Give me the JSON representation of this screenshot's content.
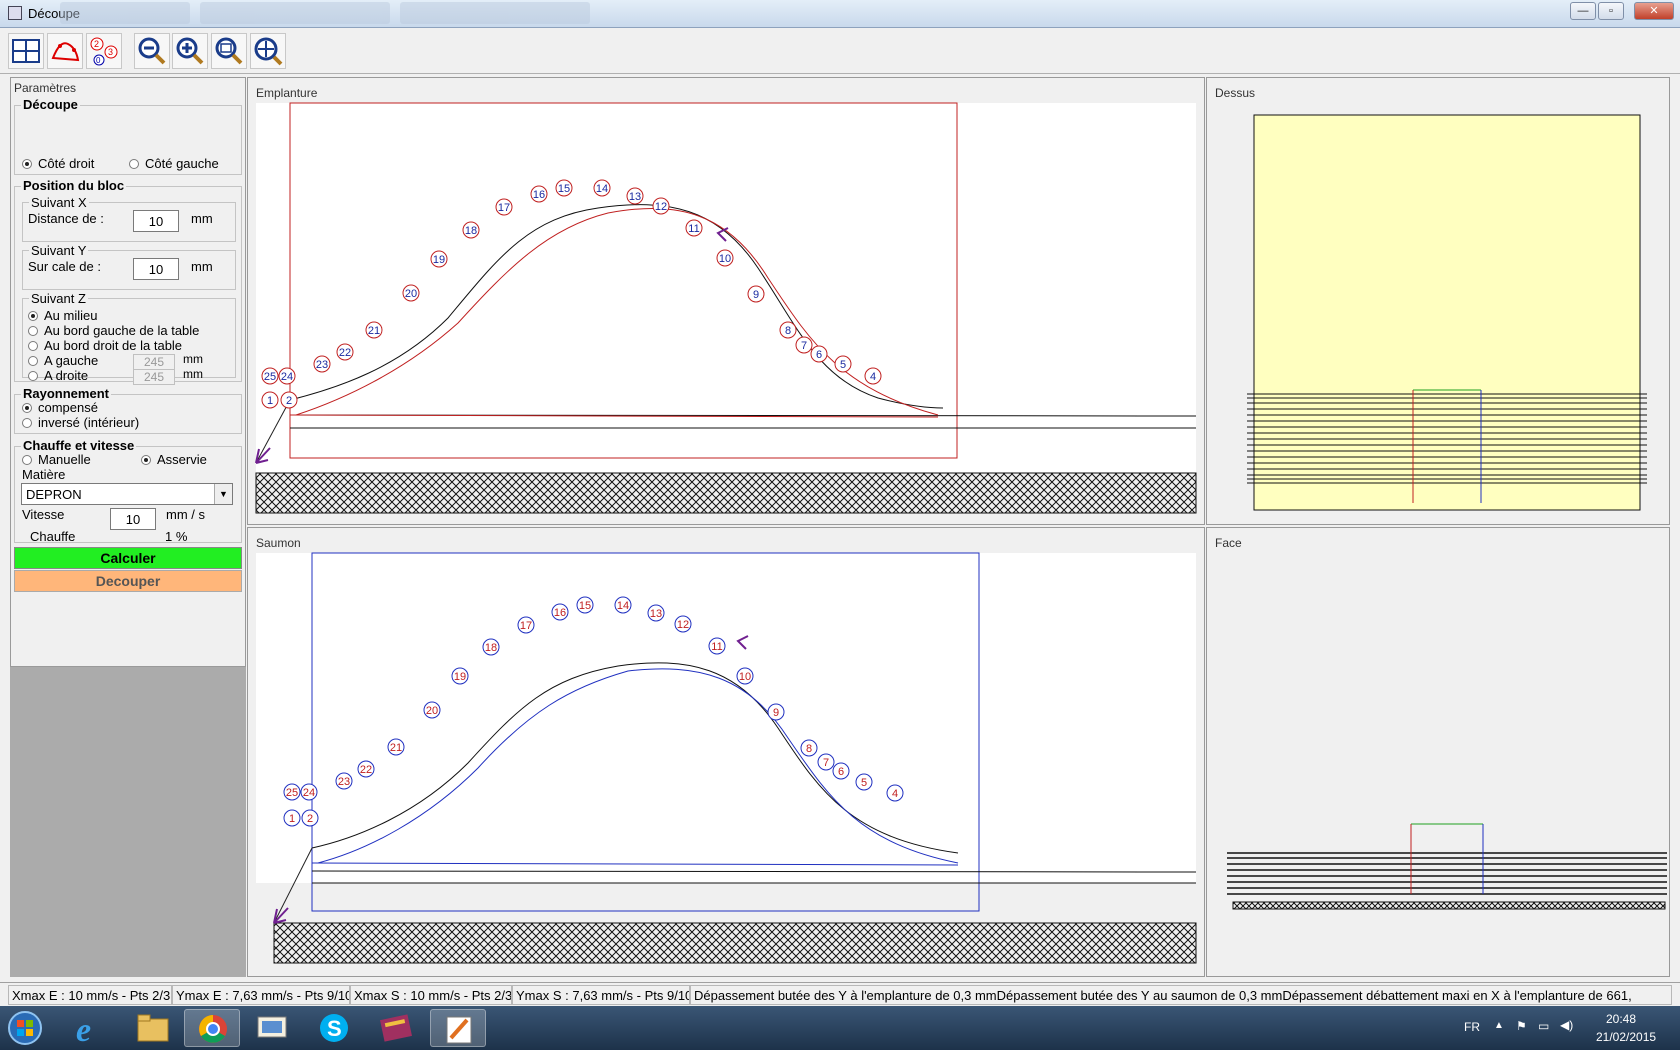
{
  "window": {
    "title": "Découpe",
    "controls": [
      "minimize",
      "maximize",
      "close"
    ]
  },
  "toolbar": {
    "buttons": [
      {
        "name": "layout-grid-icon"
      },
      {
        "name": "profile-points-icon"
      },
      {
        "name": "numbered-points-icon"
      },
      {
        "name": "zoom-out-icon"
      },
      {
        "name": "zoom-in-icon"
      },
      {
        "name": "zoom-fit-icon"
      },
      {
        "name": "pan-icon"
      }
    ]
  },
  "params": {
    "title": "Paramètres",
    "decoupe": {
      "title": "Découpe",
      "cote_droit": "Côté droit",
      "cote_gauche": "Côté gauche",
      "selected": "Côté droit"
    },
    "position": {
      "title": "Position du bloc",
      "suivant_x": "Suivant X",
      "distance_label": "Distance de :",
      "distance_value": "10",
      "distance_unit": "mm",
      "suivant_y": "Suivant Y",
      "cale_label": "Sur cale de :",
      "cale_value": "10",
      "cale_unit": "mm",
      "suivant_z": "Suivant Z",
      "z_options": [
        "Au milieu",
        "Au bord gauche de la table",
        "Au bord droit de la table",
        "A gauche",
        "A droite"
      ],
      "z_selected": "Au milieu",
      "gauche_value": "245",
      "droite_value": "245",
      "z_unit": "mm"
    },
    "rayonnement": {
      "title": "Rayonnement",
      "compense": "compensé",
      "inverse": "inversé (intérieur)",
      "selected": "compensé"
    },
    "chauffe": {
      "title": "Chauffe et vitesse",
      "manuelle": "Manuelle",
      "asservie": "Asservie",
      "selected": "Asservie",
      "matiere_label": "Matière",
      "matiere_value": "DEPRON",
      "vitesse_label": "Vitesse",
      "vitesse_value": "10",
      "vitesse_unit": "mm / s",
      "chauffe_label": "Chauffe",
      "chauffe_value": "1 %"
    },
    "calculer": "Calculer",
    "decouper": "Decouper"
  },
  "views": {
    "emplanture": "Emplanture",
    "dessus": "Dessus",
    "saumon": "Saumon",
    "face": "Face",
    "point_labels": [
      "1",
      "2",
      "4",
      "5",
      "6",
      "7",
      "8",
      "9",
      "10",
      "11",
      "12",
      "13",
      "14",
      "15",
      "16",
      "17",
      "18",
      "19",
      "20",
      "21",
      "22",
      "23",
      "24",
      "25"
    ]
  },
  "status": {
    "cells": [
      "Xmax E : 10 mm/s - Pts 2/3",
      "Ymax E : 7,63 mm/s - Pts 9/10",
      "Xmax S : 10 mm/s - Pts 2/3",
      "Ymax S : 7,63 mm/s - Pts 9/10",
      "Dépassement butée des Y à l'emplanture de 0,3 mmDépassement butée des Y au saumon de 0,3 mmDépassement débattement maxi en X à l'emplanture de 661,"
    ]
  },
  "taskbar": {
    "apps": [
      "start-orb-icon",
      "internet-explorer-icon",
      "file-explorer-icon",
      "chrome-icon",
      "presentation-icon",
      "skype-icon",
      "winrar-icon",
      "decoupe-app-icon"
    ],
    "lang": "FR",
    "time": "20:48",
    "date": "21/02/2015"
  }
}
